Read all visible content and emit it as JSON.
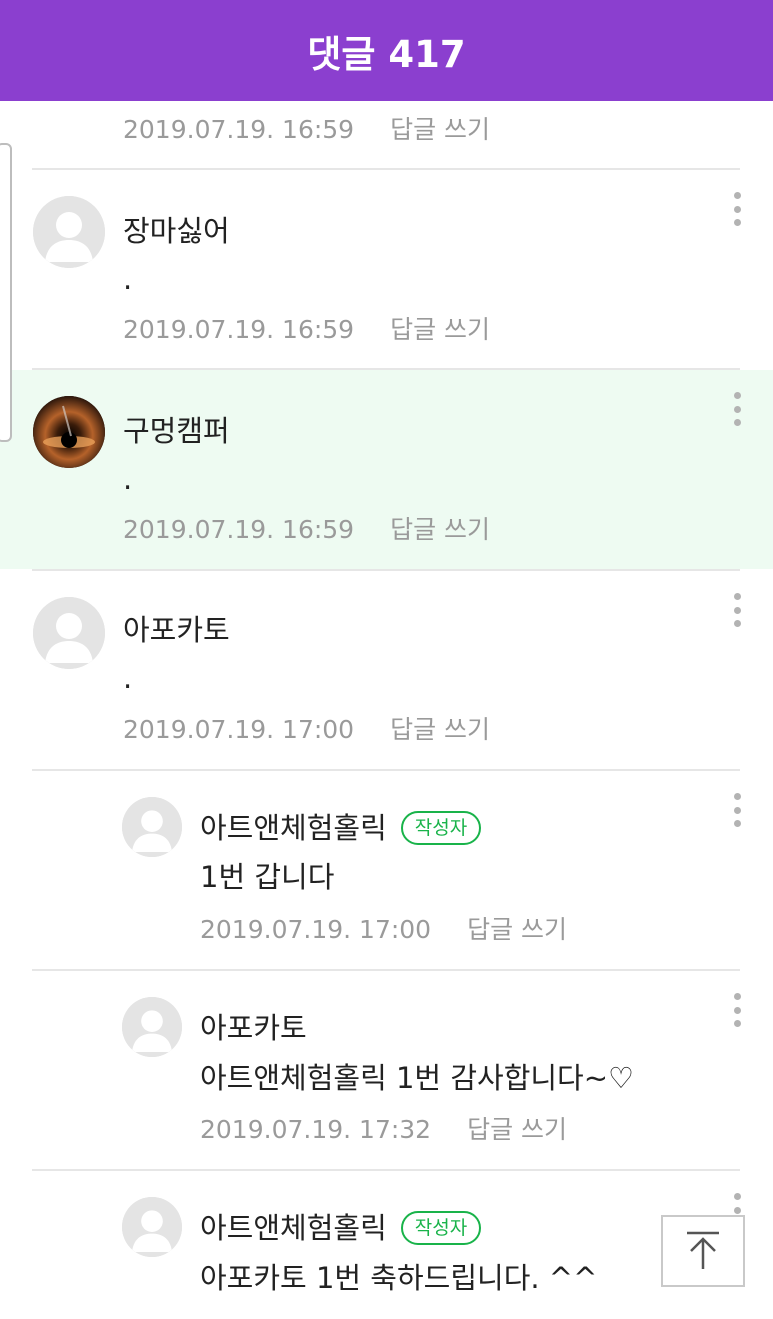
{
  "header": {
    "title": "댓글 417"
  },
  "reply_label": "답글 쓰기",
  "top_meta": {
    "date": "2019.07.19. 16:59"
  },
  "comments": [
    {
      "author": "장마싫어",
      "text": ".",
      "date": "2019.07.19. 16:59",
      "avatar": "default-avatar"
    },
    {
      "author": "구멍캠퍼",
      "text": ".",
      "date": "2019.07.19. 16:59",
      "avatar": "black-hole-avatar",
      "highlighted": true
    },
    {
      "author": "아포카토",
      "text": ".",
      "date": "2019.07.19. 17:00",
      "avatar": "default-avatar"
    }
  ],
  "replies": [
    {
      "author": "아트앤체험홀릭",
      "badge": "작성자",
      "text": "1번 갑니다",
      "date": "2019.07.19. 17:00"
    },
    {
      "author": "아포카토",
      "text": "아트앤체험홀릭 1번 감사합니다~♡",
      "date": "2019.07.19. 17:32"
    },
    {
      "author": "아트앤체험홀릭",
      "badge": "작성자",
      "text": "아포카토 1번 축하드립니다. ^^"
    }
  ],
  "colors": {
    "header": "#8b3fcf",
    "highlight": "#eefbf2",
    "badge": "#19b34a",
    "meta": "#9a9a9a"
  },
  "icons": [
    "more-vert-icon",
    "scroll-top-icon",
    "default-avatar-icon"
  ]
}
